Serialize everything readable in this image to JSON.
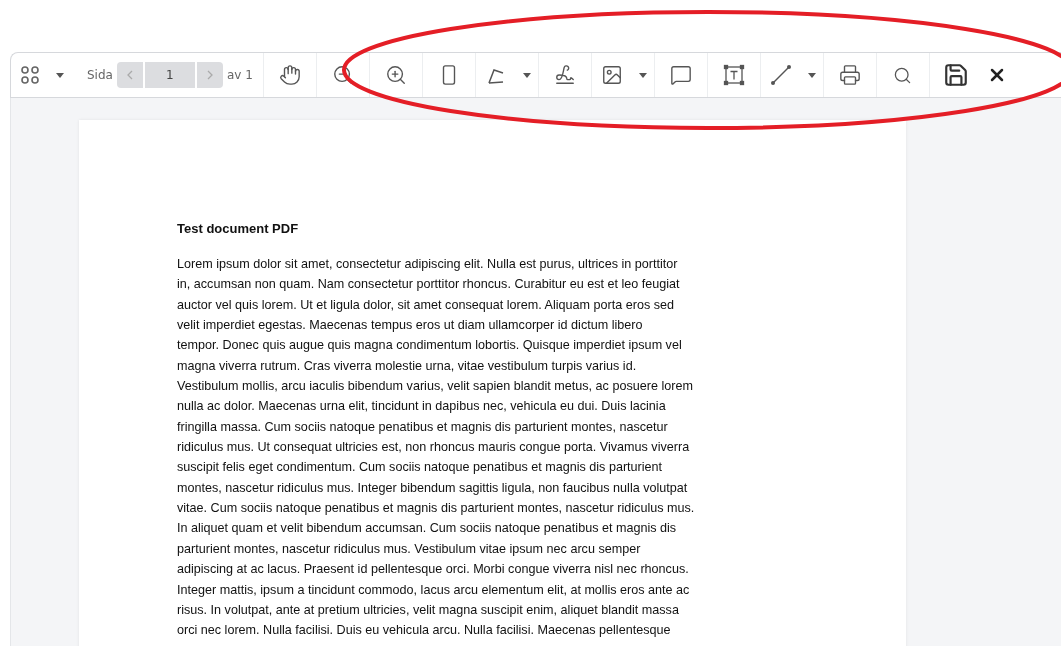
{
  "toolbar": {
    "page_label": "Sida",
    "page_value": "1",
    "page_total": "av 1"
  },
  "document": {
    "title": "Test document PDF",
    "lines": [
      "Lorem ipsum dolor sit amet, consectetur adipiscing elit. Nulla est purus, ultrices in porttitor",
      "in, accumsan non quam. Nam consectetur porttitor rhoncus. Curabitur eu est et leo feugiat",
      "auctor vel quis lorem. Ut et ligula dolor, sit amet consequat lorem. Aliquam porta eros sed",
      "velit imperdiet egestas. Maecenas tempus eros ut diam ullamcorper id dictum libero",
      "tempor. Donec quis augue quis magna condimentum lobortis. Quisque imperdiet ipsum vel",
      "magna viverra rutrum. Cras viverra molestie urna, vitae vestibulum turpis varius id.",
      "Vestibulum mollis, arcu iaculis bibendum varius, velit sapien blandit metus, ac posuere lorem",
      "nulla ac dolor. Maecenas urna elit, tincidunt in dapibus nec, vehicula eu dui. Duis lacinia",
      "fringilla massa. Cum sociis natoque penatibus et magnis dis parturient montes, nascetur",
      "ridiculus mus. Ut consequat ultricies est, non rhoncus mauris congue porta. Vivamus viverra",
      "suscipit felis eget condimentum. Cum sociis natoque penatibus et magnis dis parturient",
      "montes, nascetur ridiculus mus. Integer bibendum sagittis ligula, non faucibus nulla volutpat",
      "vitae. Cum sociis natoque penatibus et magnis dis parturient montes, nascetur ridiculus mus.",
      "In aliquet quam et velit bibendum accumsan. Cum sociis natoque penatibus et magnis dis",
      "parturient montes, nascetur ridiculus mus. Vestibulum vitae ipsum nec arcu semper",
      "adipiscing at ac lacus. Praesent id pellentesque orci. Morbi congue viverra nisl nec rhoncus.",
      "Integer mattis, ipsum a tincidunt commodo, lacus arcu elementum elit, at mollis eros ante ac",
      "risus. In volutpat, ante at pretium ultricies, velit magna suscipit enim, aliquet blandit massa",
      "orci nec lorem. Nulla facilisi. Duis eu vehicula arcu. Nulla facilisi. Maecenas pellentesque"
    ]
  }
}
